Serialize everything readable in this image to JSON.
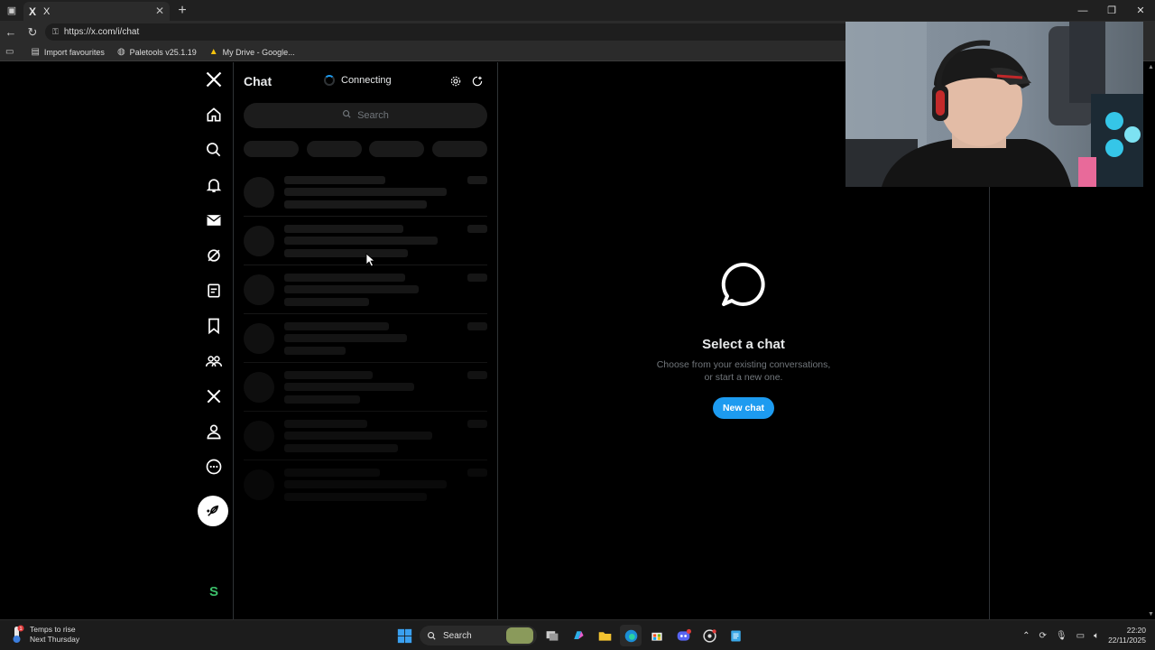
{
  "browser": {
    "tab_title": "X",
    "tab_favicon": "X",
    "url": "https://x.com/i/chat",
    "bookmarks": [
      {
        "label": "Import favourites",
        "icon": "folder-icon"
      },
      {
        "label": "Paletools v25.1.19",
        "icon": "globe-icon"
      },
      {
        "label": "My Drive - Google...",
        "icon": "drive-icon"
      }
    ]
  },
  "chat": {
    "title": "Chat",
    "status": "Connecting",
    "search_placeholder": "Search"
  },
  "empty_state": {
    "title": "Select a chat",
    "subtitle_line1": "Choose from your existing conversations,",
    "subtitle_line2": "or start a new one.",
    "button_label": "New chat"
  },
  "taskbar": {
    "weather_title": "Temps to rise",
    "weather_sub": "Next Thursday",
    "weather_badge": "1",
    "search_label": "Search",
    "time": "22:20",
    "date": "22/11/2025"
  },
  "colors": {
    "accent": "#1d9bf0",
    "background": "#000000",
    "border": "#2f3336",
    "muted_text": "#71767b"
  }
}
